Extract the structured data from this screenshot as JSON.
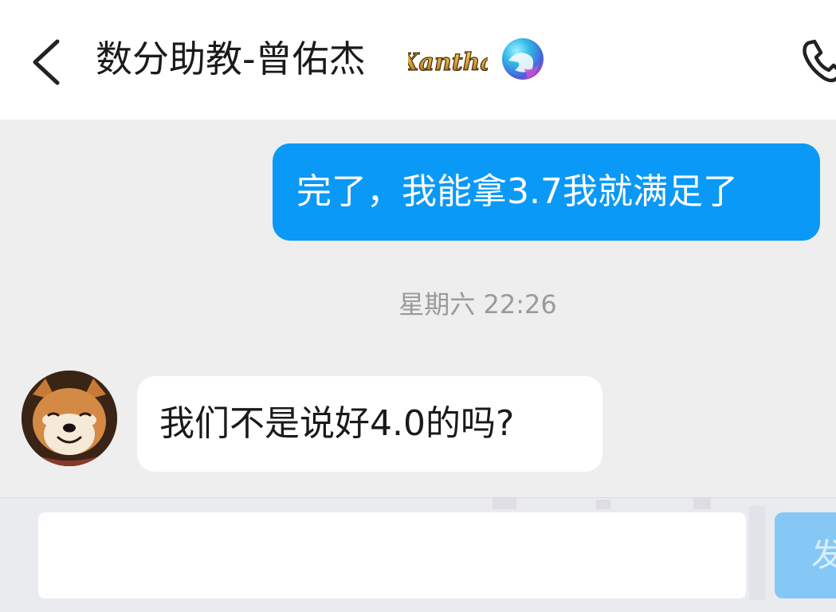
{
  "header": {
    "back_icon": "chevron-left-icon",
    "title": "数分助教-曾佑杰",
    "vip_badge_text": "Xantha",
    "phone_icon": "phone-icon"
  },
  "messages": [
    {
      "direction": "outgoing",
      "text": "完了，我能拿3.7我就满足了"
    },
    {
      "type": "timestamp",
      "text": "星期六 22:26"
    },
    {
      "direction": "incoming",
      "text": "我们不是说好4.0的吗?",
      "avatar": "shiba-dog-avatar"
    }
  ],
  "input": {
    "value": "",
    "placeholder": "",
    "send_label": "发"
  },
  "colors": {
    "outgoing_bubble": "#0a99f7",
    "incoming_bubble": "#ffffff",
    "chat_background": "#eeeeee",
    "send_button": "#86c8f5"
  }
}
